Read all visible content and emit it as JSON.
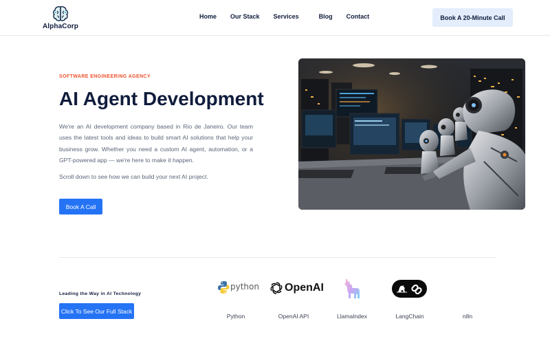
{
  "header": {
    "logo_text": "AlphaCorp",
    "nav": [
      "Home",
      "Our Stack",
      "Services",
      "Blog",
      "Contact"
    ],
    "cta": "Book A 20-Minute Call"
  },
  "hero": {
    "eyebrow": "SOFTWARE ENGINEERING AGENCY",
    "title": "AI Agent Development",
    "lead": "We're an AI development company based in Rio de Janeiro. Our team uses the latest tools and ideas to build smart AI solutions that help your business grow. Whether you need a custom AI agent, automation, or a GPT-powered app — we're here to make it happen.",
    "scroll_note": "Scroll down to see how we can build your next AI project.",
    "button": "Book A Call",
    "image_icon": "robots-in-server-room-photo"
  },
  "stack": {
    "label": "Leading the Way in AI Technology",
    "button": "Click To See Our Full Stack",
    "tools": [
      {
        "name": "Python",
        "logo_text": "python",
        "icon": "python-logo-icon"
      },
      {
        "name": "OpenAI API",
        "logo_text": "OpenAI",
        "icon": "openai-logo-icon"
      },
      {
        "name": "LlamaIndex",
        "logo_text": "",
        "icon": "llama-logo-icon"
      },
      {
        "name": "LangChain",
        "logo_text": "",
        "icon": "langchain-logo-icon"
      },
      {
        "name": "n8n",
        "logo_text": "",
        "icon": "n8n-logo-icon"
      }
    ]
  },
  "colors": {
    "brand_navy": "#101c3c",
    "accent_orange": "#f0512b",
    "button_blue": "#2573f5",
    "cta_light": "#e3edfc"
  }
}
